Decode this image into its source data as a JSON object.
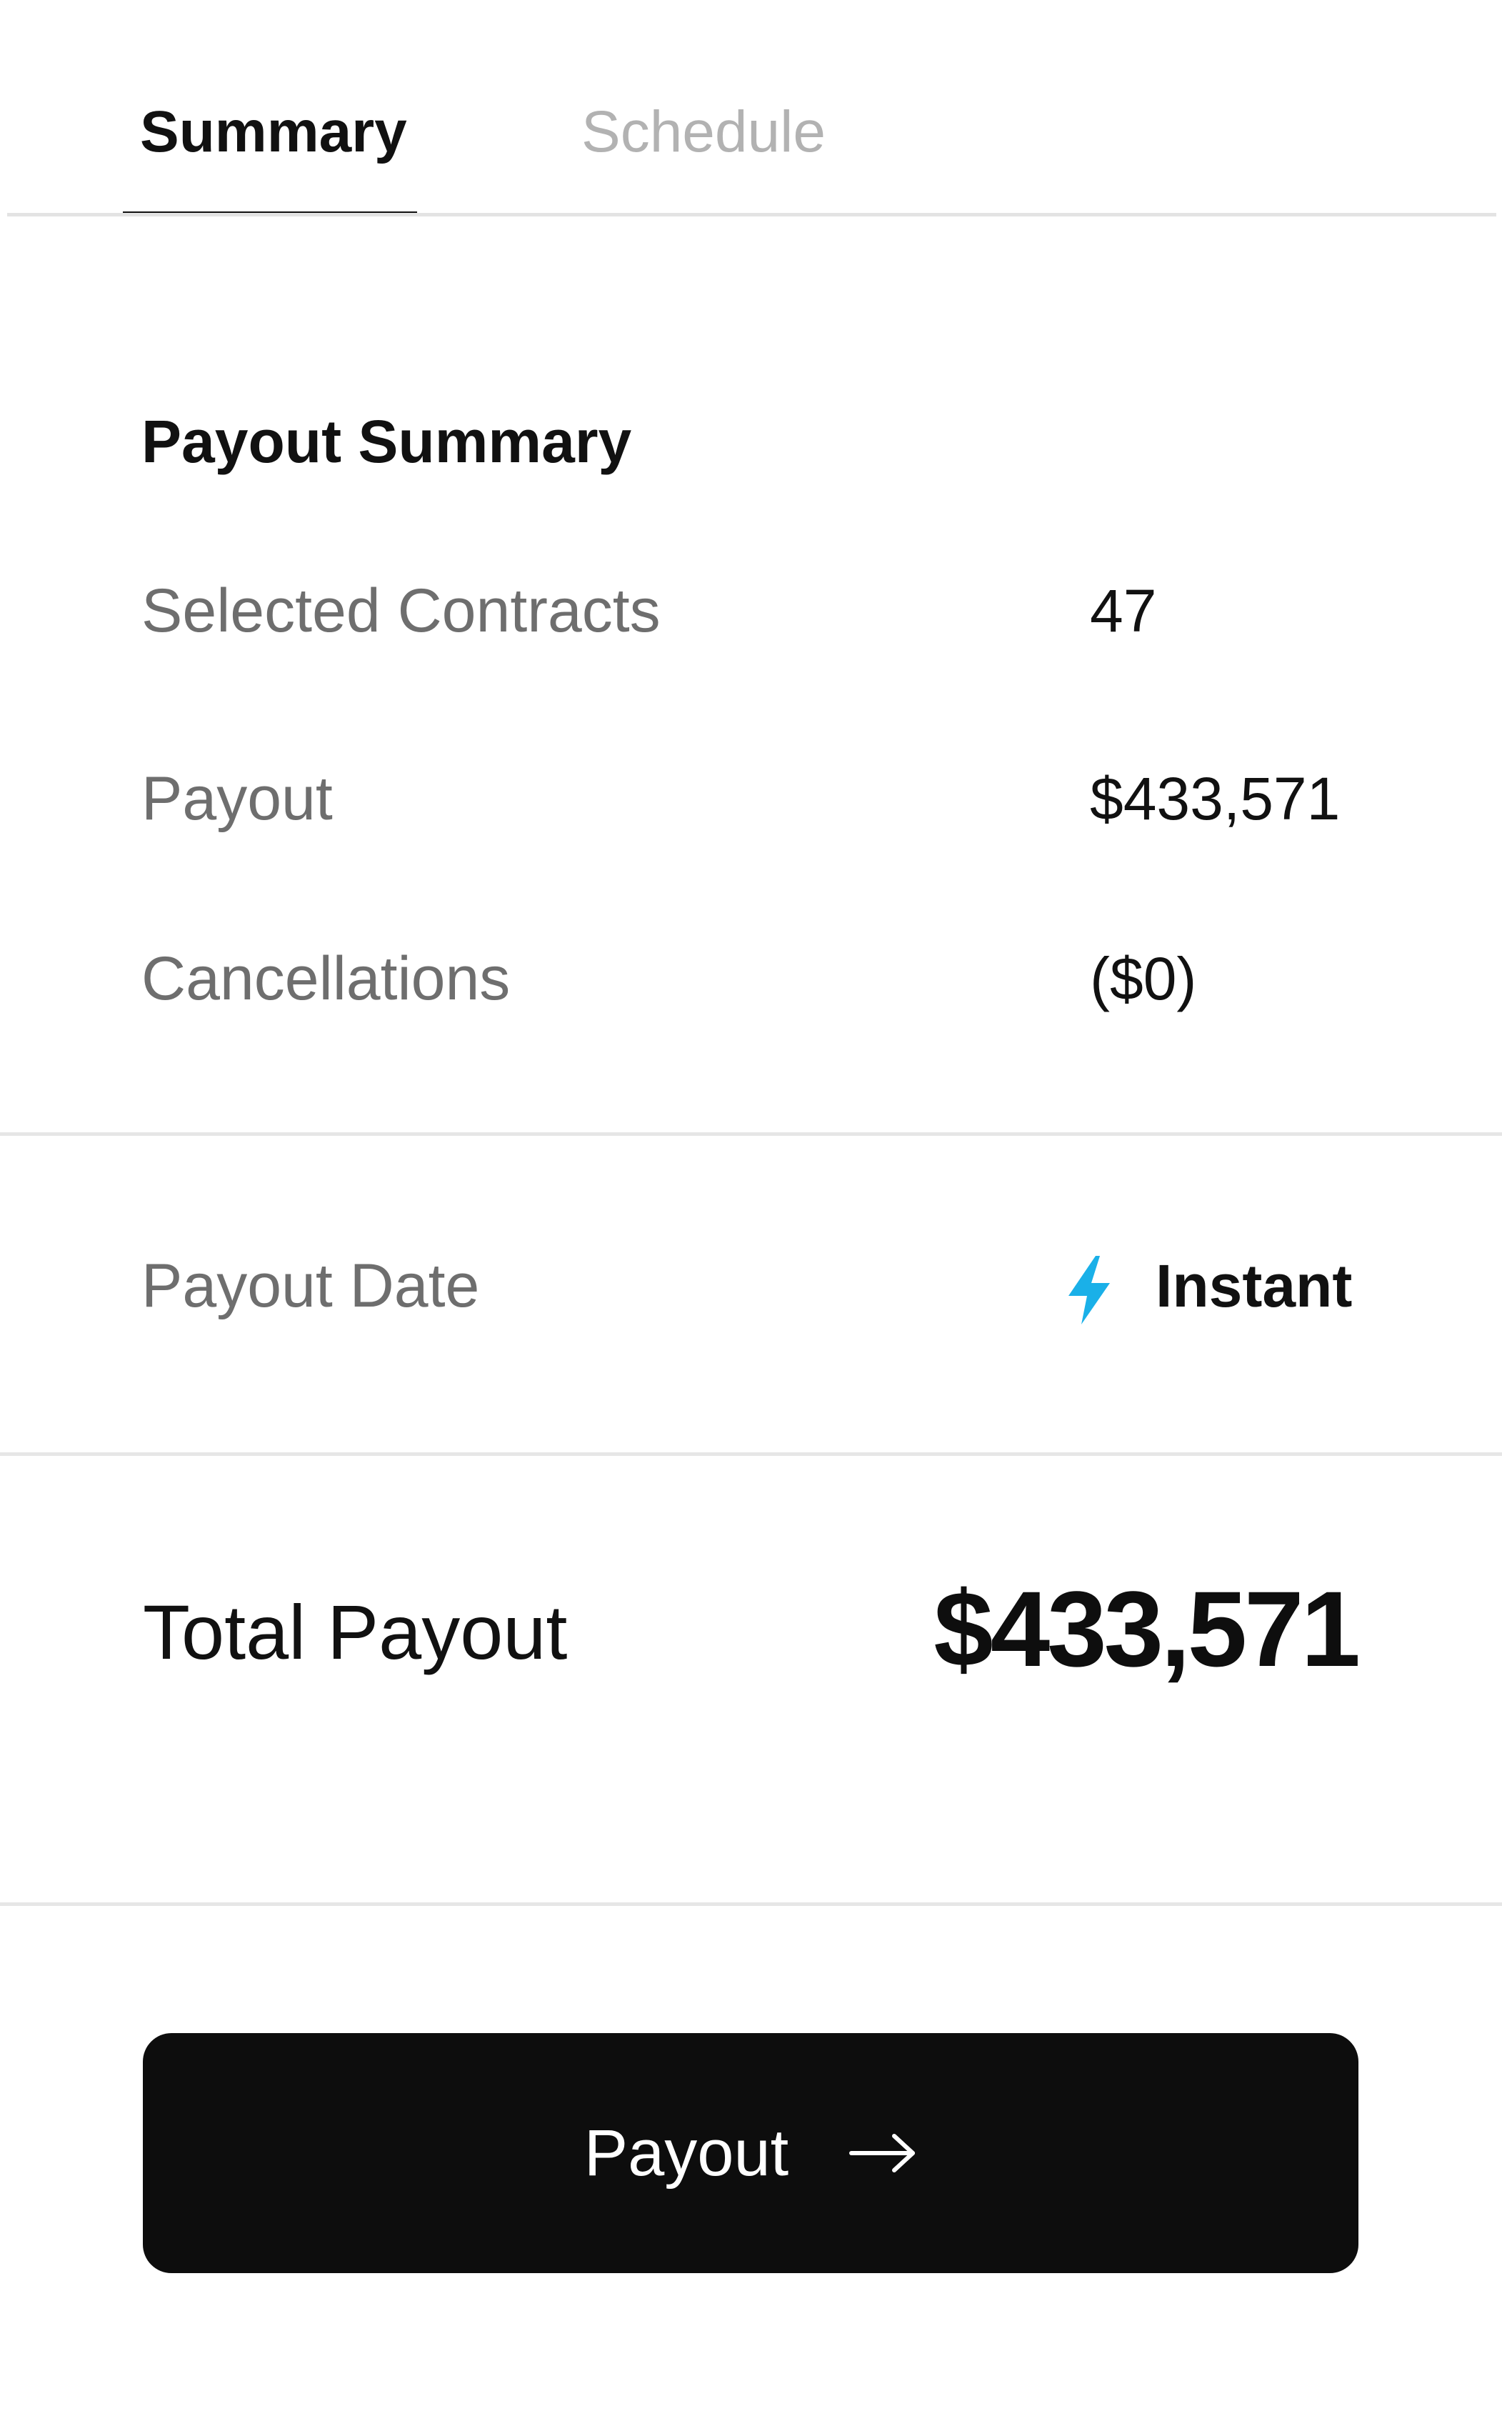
{
  "tabs": [
    {
      "label": "Summary",
      "active": true
    },
    {
      "label": "Schedule",
      "active": false
    }
  ],
  "summary": {
    "title": "Payout Summary",
    "rows": [
      {
        "label": "Selected Contracts",
        "value": "47"
      },
      {
        "label": "Payout",
        "value": "$433,571"
      },
      {
        "label": "Cancellations",
        "value": "($0)"
      }
    ]
  },
  "payout_date": {
    "label": "Payout Date",
    "value": "Instant",
    "icon": "lightning-bolt-icon",
    "icon_color": "#1ab0e8"
  },
  "total": {
    "label": "Total Payout",
    "value": "$433,571"
  },
  "button": {
    "label": "Payout",
    "icon": "arrow-right-icon",
    "background": "#0d0d0d"
  }
}
